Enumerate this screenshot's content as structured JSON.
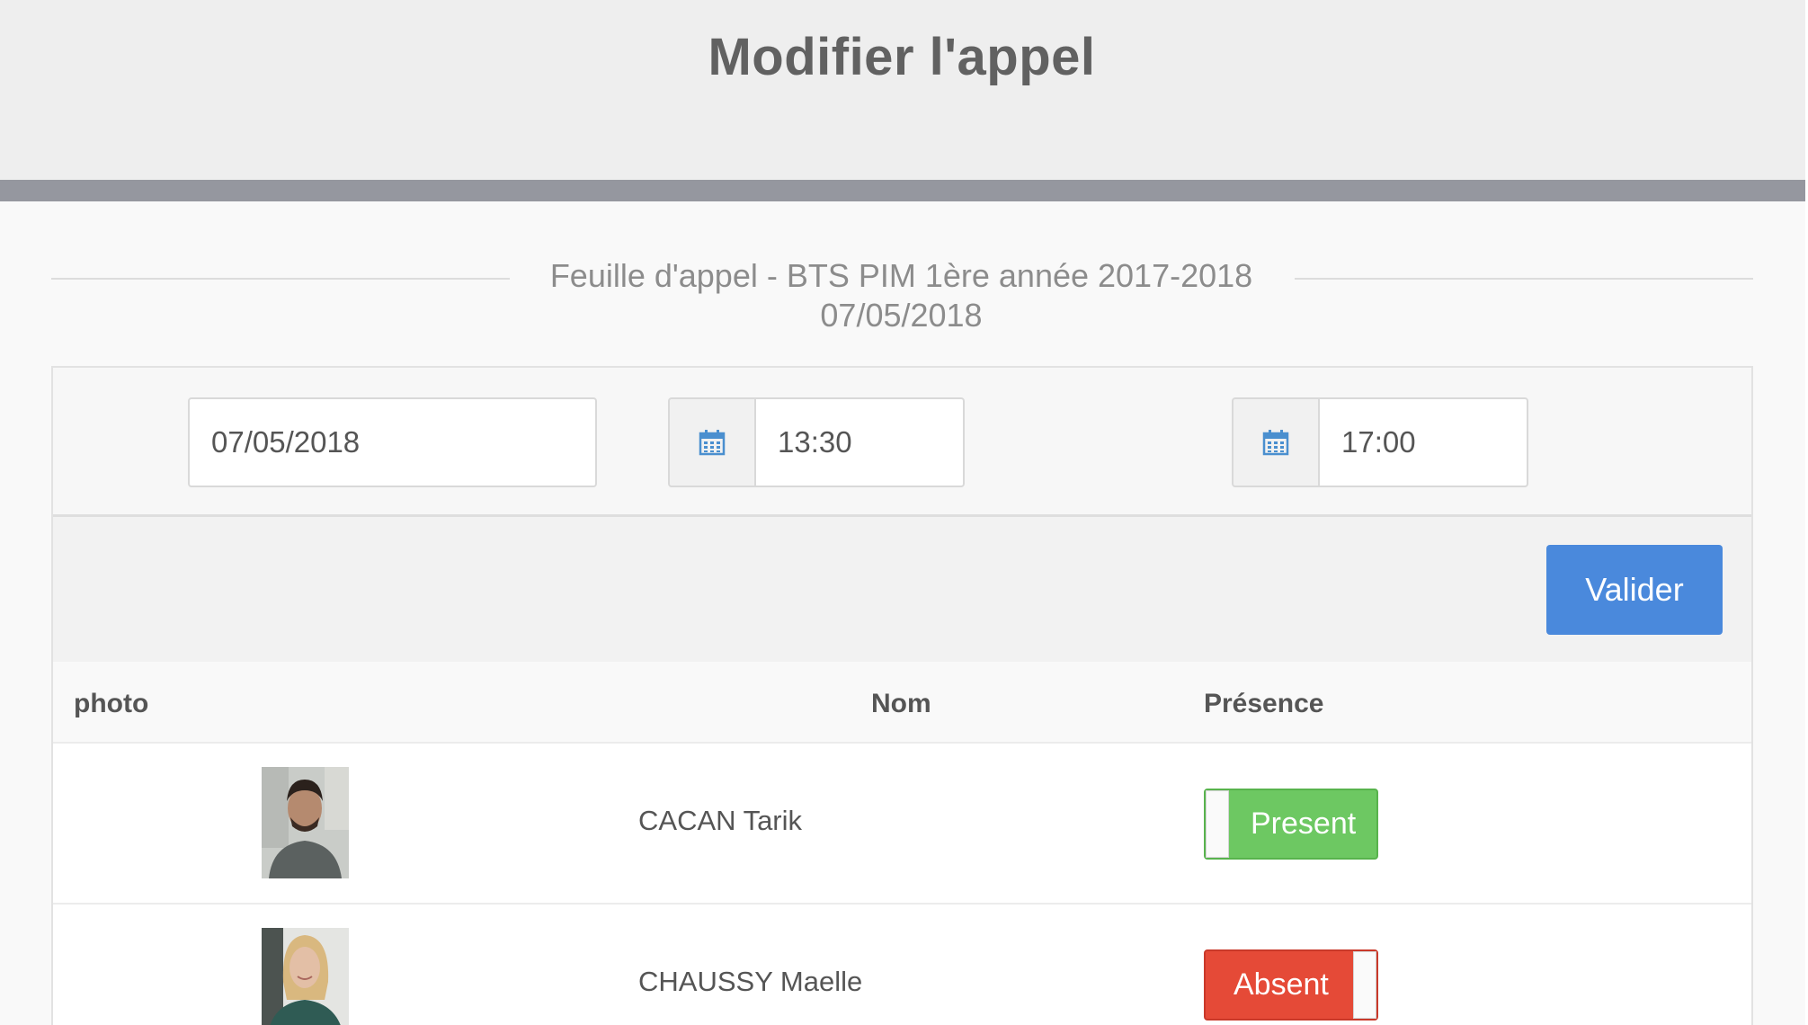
{
  "header": {
    "title": "Modifier l'appel"
  },
  "sheet": {
    "title": "Feuille d'appel - BTS PIM 1ère année 2017-2018",
    "date": "07/05/2018"
  },
  "filters": {
    "date_value": "07/05/2018",
    "start_time": "13:30",
    "end_time": "17:00",
    "icon": "calendar-icon",
    "icon_color": "#4a8fcf"
  },
  "actions": {
    "validate_label": "Valider",
    "validate_color": "#4a89dc"
  },
  "table": {
    "columns": [
      "photo",
      "Nom",
      "Présence"
    ],
    "rows": [
      {
        "name": "CACAN Tarik",
        "presence": "Present",
        "status": "present"
      },
      {
        "name": "CHAUSSY Maelle",
        "presence": "Absent",
        "status": "absent"
      }
    ]
  },
  "colors": {
    "present": "#6dc862",
    "absent": "#e54a37",
    "header_bar": "#95979f"
  }
}
